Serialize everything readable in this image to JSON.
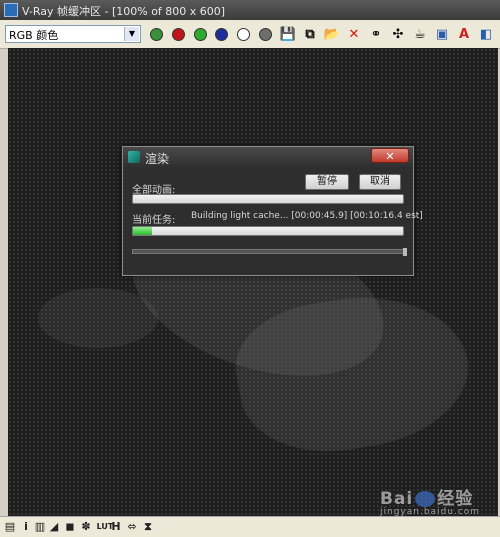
{
  "window": {
    "title": "V-Ray 帧缓冲区 - [100% of 800 x 600]"
  },
  "toolbar": {
    "channel": "RGB 颜色",
    "buttons": [
      {
        "icon": "color-channel-icon",
        "color": "#3a8f3a"
      },
      {
        "icon": "red-channel-icon",
        "color": "#c0151b"
      },
      {
        "icon": "green-channel-icon",
        "color": "#2fa82f"
      },
      {
        "icon": "blue-channel-icon",
        "color": "#1b2e9b"
      },
      {
        "icon": "alpha-channel-icon",
        "color": "#ffffff"
      },
      {
        "icon": "mono-channel-icon",
        "color": "#6e6e6e"
      },
      {
        "icon": "save-icon",
        "glyph": "💾"
      },
      {
        "icon": "copy-icon",
        "glyph": "⧉"
      },
      {
        "icon": "open-folder-icon",
        "glyph": "📂"
      },
      {
        "icon": "clear-icon",
        "glyph": "✕",
        "color": "#d11"
      },
      {
        "icon": "link-icon",
        "glyph": "⚭"
      },
      {
        "icon": "track-mouse-icon",
        "glyph": "✣"
      },
      {
        "icon": "render-teapot-icon",
        "glyph": "☕"
      },
      {
        "icon": "region-render-icon",
        "glyph": "▣",
        "color": "#2a5db0"
      },
      {
        "icon": "ab-compare-icon",
        "glyph": "A",
        "color": "#c22"
      },
      {
        "icon": "color-correction-icon",
        "glyph": "◧",
        "color": "#2a5db0"
      }
    ]
  },
  "dialog": {
    "title": "渲染",
    "close_glyph": "✕",
    "total_label": "全部动画:",
    "pause_label": "暂停",
    "cancel_label": "取消",
    "task_label": "当前任务:",
    "task_text": "Building light cache... [00:00:45.9] [00:10:16.4 est]",
    "total_progress": 0,
    "task_progress": 0.07
  },
  "watermark": {
    "text_left": "Bai",
    "text_right": "经验",
    "text_small": "jingyan.baidu.com"
  },
  "statusbar": {
    "buttons": [
      {
        "icon": "panel-icon",
        "glyph": "▤"
      },
      {
        "icon": "info-icon",
        "glyph": "i"
      },
      {
        "icon": "histogram-icon",
        "glyph": "▥"
      },
      {
        "icon": "levels-icon",
        "glyph": "◢"
      },
      {
        "icon": "dark-icon",
        "glyph": "◼"
      },
      {
        "icon": "settings-icon",
        "glyph": "✽"
      },
      {
        "icon": "lut-icon",
        "glyph": "LUT"
      },
      {
        "icon": "h-icon",
        "glyph": "H"
      },
      {
        "icon": "stereo-icon",
        "glyph": "⬄"
      },
      {
        "icon": "layers-icon",
        "glyph": "⧗"
      }
    ]
  }
}
